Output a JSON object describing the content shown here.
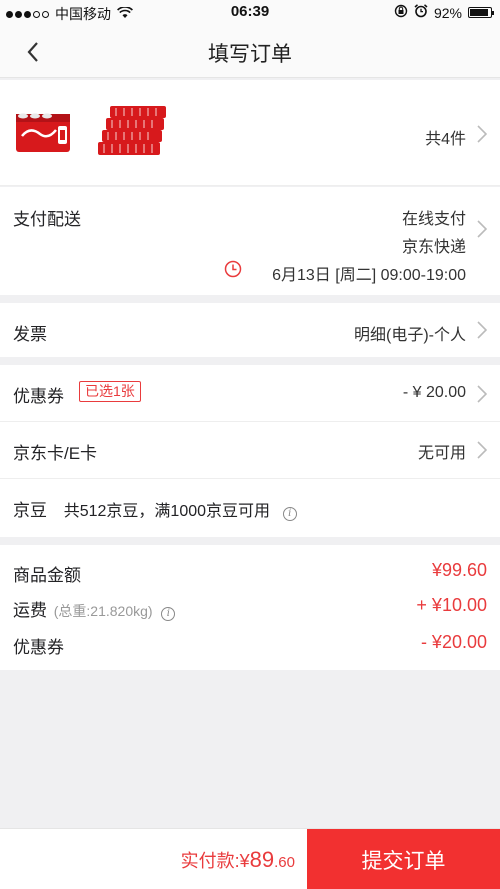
{
  "status": {
    "carrier": "中国移动",
    "time": "06:39",
    "battery": "92%",
    "battery_level": 0.92
  },
  "nav": {
    "title": "填写订单"
  },
  "goods": {
    "count_text": "共4件"
  },
  "payment": {
    "label": "支付配送",
    "method": "在线支付",
    "courier": "京东快递",
    "schedule": "6月13日 [周二] 09:00-19:00"
  },
  "invoice": {
    "label": "发票",
    "value": "明细(电子)-个人"
  },
  "coupon": {
    "label": "优惠券",
    "badge": "已选1张",
    "value": "- ¥ 20.00"
  },
  "jdcard": {
    "label": "京东卡/E卡",
    "value": "无可用"
  },
  "beans": {
    "label": "京豆",
    "text": "共512京豆，满1000京豆可用"
  },
  "summary": {
    "goods_label": "商品金额",
    "goods_value": "¥99.60",
    "freight_label": "运费",
    "freight_note": "(总重:21.820kg)",
    "freight_value": "+ ¥10.00",
    "coupon_label": "优惠券",
    "coupon_value": "- ¥20.00"
  },
  "bottom": {
    "total_label": "实付款:¥",
    "total_int": "89",
    "total_dec": ".60",
    "submit_label": "提交订单"
  },
  "colors": {
    "accent": "#e93b3d",
    "submit": "#f23030"
  },
  "icons": [
    "signal-dots-icon",
    "wifi-icon",
    "lock-rotation-icon",
    "alarm-icon",
    "battery-icon",
    "back-icon",
    "chevron-right-icon",
    "clock-icon",
    "info-icon"
  ]
}
